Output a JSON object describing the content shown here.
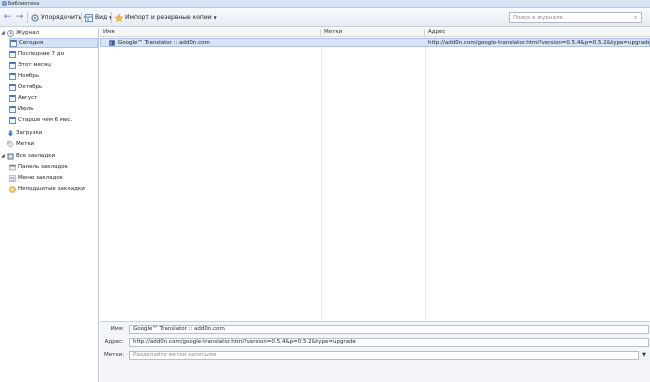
{
  "window": {
    "title": "Библиотека"
  },
  "toolbar": {
    "organize": "Упорядочить",
    "views": "Вид",
    "import_backup": "Импорт и резервные копии"
  },
  "search": {
    "placeholder": "Поиск в журнале"
  },
  "sidebar": {
    "history": "Журнал",
    "history_items": [
      "Сегодня",
      "Последние 7 дн",
      "Этот месяц",
      "Ноябрь",
      "Октябрь",
      "Август",
      "Июль",
      "Старше чем 6 мес."
    ],
    "downloads": "Загрузки",
    "tags": "Метки",
    "all_bookmarks": "Все закладки",
    "bookmark_items": [
      "Панель закладок",
      "Меню закладок",
      "Неподшитые закладки"
    ]
  },
  "columns": {
    "name": "Имя",
    "tags": "Метки",
    "address": "Адрес"
  },
  "rows": [
    {
      "name": "Google™ Translator :: add0n.com",
      "tags": "",
      "address": "http://add0n.com/google-translator.html?version=0.5.4&p=0.5.2&type=upgrade"
    }
  ],
  "details": {
    "name_label": "Имя:",
    "name_value": "Google™ Translator :: add0n.com",
    "address_label": "Адрес:",
    "address_value": "http://add0n.com/google-translator.html?version=0.5.4&p=0.5.2&type=upgrade",
    "tags_label": "Метки:",
    "tags_placeholder": "Разделяйте метки запятыми"
  }
}
